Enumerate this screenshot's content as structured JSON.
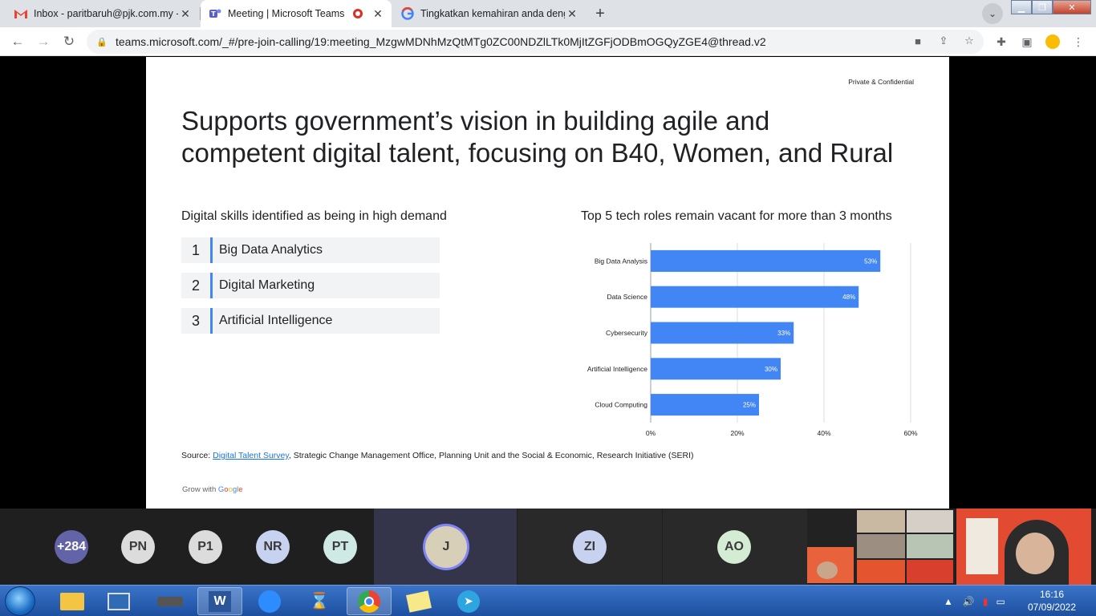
{
  "browser": {
    "tabs": [
      {
        "title": "Inbox - paritbaruh@pjk.com.my -",
        "icon": "gmail-icon"
      },
      {
        "title": "Meeting | Microsoft Teams",
        "icon": "teams-icon",
        "recording": true
      },
      {
        "title": "Tingkatkan kemahiran anda deng",
        "icon": "google-icon"
      }
    ],
    "url": "teams.microsoft.com/_#/pre-join-calling/19:meeting_MzgwMDNhMzQtMTg0ZC00NDZlLTk0MjItZGFjODBmOGQyZGE4@thread.v2"
  },
  "slide": {
    "confidential": "Private & Confidential",
    "title_line1": "Supports government’s vision in building agile and",
    "title_line2": "competent digital talent, focusing on B40, Women, and Rural",
    "left_heading": "Digital skills identified as being in high demand",
    "skills": [
      {
        "num": "1",
        "label": "Big Data Analytics"
      },
      {
        "num": "2",
        "label": "Digital Marketing"
      },
      {
        "num": "3",
        "label": "Artificial Intelligence"
      }
    ],
    "right_heading": "Top 5 tech roles remain vacant for more than 3 months",
    "source_prefix": "Source: ",
    "source_link": "Digital Talent Survey",
    "source_rest": ", Strategic Change Management Office, Planning Unit and the Social & Economic, Research Initiative (SERI)",
    "grow_prefix": "Grow with ",
    "grow_brand": [
      "G",
      "o",
      "o",
      "g",
      "l",
      "e"
    ]
  },
  "chart_data": {
    "type": "bar",
    "orientation": "horizontal",
    "categories": [
      "Big Data Analysis",
      "Data Science",
      "Cybersecurity",
      "Artificial Intelligence",
      "Cloud Computing"
    ],
    "values": [
      53,
      48,
      33,
      30,
      25
    ],
    "value_labels": [
      "53%",
      "48%",
      "33%",
      "30%",
      "25%"
    ],
    "xlim": [
      0,
      60
    ],
    "xticks": [
      0,
      20,
      40,
      60
    ],
    "xtick_labels": [
      "0%",
      "20%",
      "40%",
      "60%"
    ],
    "grid": true,
    "bar_color": "#4285f4"
  },
  "participants": {
    "avatars": [
      {
        "initials": "+284",
        "bg": "#6264a7",
        "fg": "#ffffff"
      },
      {
        "initials": "PN",
        "bg": "#dcdcdc",
        "fg": "#3a3a3a"
      },
      {
        "initials": "P1",
        "bg": "#dcdcdc",
        "fg": "#3a3a3a"
      },
      {
        "initials": "NR",
        "bg": "#c7d2f0",
        "fg": "#3a3a3a"
      },
      {
        "initials": "PT",
        "bg": "#cfe9e4",
        "fg": "#3a3a3a"
      },
      {
        "initials": "J",
        "bg": "#d8cfb8",
        "fg": "#3a3a3a"
      },
      {
        "initials": "ZI",
        "bg": "#c7d2f0",
        "fg": "#3a3a3a"
      },
      {
        "initials": "AO",
        "bg": "#d4ecd4",
        "fg": "#3a3a3a"
      }
    ]
  },
  "taskbar": {
    "time": "16:16",
    "date": "07/09/2022"
  }
}
